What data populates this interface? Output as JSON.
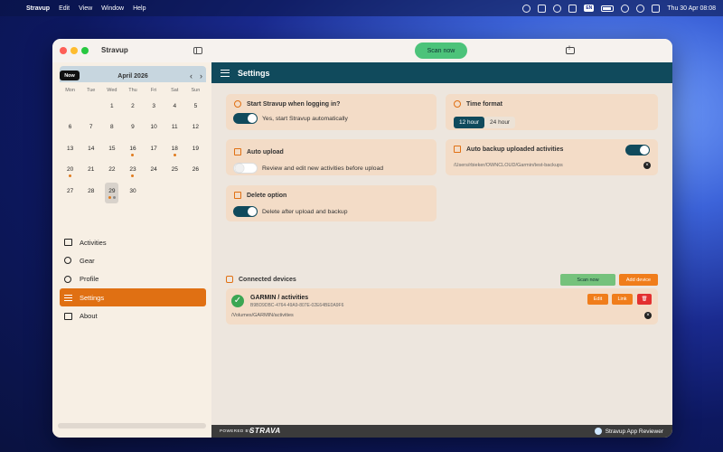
{
  "menubar": {
    "app_name": "Stravup",
    "items": [
      "Edit",
      "View",
      "Window",
      "Help"
    ],
    "clock": "Thu 30 Apr  08:08"
  },
  "window": {
    "title": "Stravup",
    "scan_now": "Scan now"
  },
  "calendar": {
    "now_label": "Now",
    "month": "April 2026",
    "prev": "‹",
    "next": "›",
    "weekdays": [
      "Mon",
      "Tue",
      "Wed",
      "Thu",
      "Fri",
      "Sat",
      "Sun"
    ],
    "days": [
      "",
      "",
      "1",
      "2",
      "3",
      "4",
      "5",
      "6",
      "7",
      "8",
      "9",
      "10",
      "11",
      "12",
      "13",
      "14",
      "15",
      "16",
      "17",
      "18",
      "19",
      "20",
      "21",
      "22",
      "23",
      "24",
      "25",
      "26",
      "27",
      "28",
      "29",
      "30",
      "",
      "",
      ""
    ],
    "activity_days": [
      "16",
      "18",
      "20",
      "23",
      "29"
    ],
    "today": "29"
  },
  "nav": {
    "items": [
      {
        "label": "Activities",
        "icon": "activities-icon"
      },
      {
        "label": "Gear",
        "icon": "gear-icon"
      },
      {
        "label": "Profile",
        "icon": "profile-icon"
      },
      {
        "label": "Settings",
        "icon": "settings-icon"
      },
      {
        "label": "About",
        "icon": "about-icon"
      }
    ],
    "active": "Settings"
  },
  "settings": {
    "header": "Settings",
    "start_login": {
      "title": "Start Stravup when logging in?",
      "toggle_label": "Yes, start Stravup automatically",
      "on": true
    },
    "time_format": {
      "title": "Time format",
      "options": [
        "12 hour",
        "24 hour"
      ],
      "selected": "12 hour"
    },
    "auto_upload": {
      "title": "Auto upload",
      "toggle_label": "Review and edit new activities before upload",
      "on": false
    },
    "auto_backup": {
      "title": "Auto backup uploaded activities",
      "path": "/Users/rbieker/OWNCLOUD/Garmin/test-backups",
      "on": true
    },
    "delete_option": {
      "title": "Delete option",
      "toggle_label": "Delete after upload and backup",
      "on": true
    },
    "devices": {
      "title": "Connected devices",
      "scan_now": "Scan now",
      "add_device": "Add device",
      "list": [
        {
          "name": "GARMIN / activities",
          "id": "B9BD9DBC-4764-49A9-807E-02E64BE0A9F6",
          "path": "/Volumes/GARMIN/activities",
          "edit": "Edit",
          "link": "Link"
        }
      ]
    }
  },
  "footer": {
    "powered_by": "POWERED BY",
    "brand": "STRAVA",
    "reviewer": "Stravup App Reviewer"
  },
  "colors": {
    "accent_orange": "#e07013",
    "header_teal": "#104a5c",
    "card_bg": "#f3dcc7",
    "scan_green": "#4cc37a"
  }
}
